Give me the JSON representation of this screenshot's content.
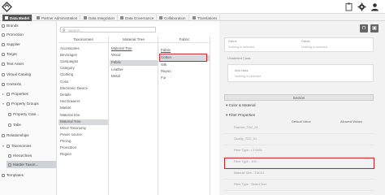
{
  "tabs": [
    {
      "label": "Data Model"
    },
    {
      "label": "Partner Administration"
    },
    {
      "label": "Data Integration"
    },
    {
      "label": "Data Governance"
    },
    {
      "label": "Collaboration"
    },
    {
      "label": "Translations"
    }
  ],
  "sidebar": {
    "items": [
      {
        "label": "Brands"
      },
      {
        "label": "Promotion"
      },
      {
        "label": "Supplier"
      },
      {
        "label": "Target"
      },
      {
        "label": "Text Asset"
      },
      {
        "label": "Virtual Catalog"
      },
      {
        "label": "Contexts"
      },
      {
        "label": "Properties"
      },
      {
        "label": "Property Groups"
      },
      {
        "label": "Property Cate..."
      },
      {
        "label": "Tabs"
      },
      {
        "label": "Relationships"
      },
      {
        "label": "Taxonomies"
      },
      {
        "label": "Hierarchies"
      },
      {
        "label": "Master Taxon..."
      },
      {
        "label": "Templates"
      }
    ]
  },
  "search": {
    "placeholder": "Search..."
  },
  "columns": {
    "taxonomies": {
      "header": "Taxonomies",
      "items": [
        "Accessories",
        "Beverages",
        "Campaigns",
        "Category",
        "Clothing",
        "Color",
        "Electronic Device",
        "Details",
        "Hat Drawers",
        "Market",
        "Material tree",
        "Material Tree",
        "Minor Taxonomy",
        "Power source",
        "Pricing",
        "Promotion",
        "Region"
      ]
    },
    "material_tree": {
      "header": "Material Tree",
      "items": [
        "Material Tree",
        "Wood",
        "Fabric",
        "Leather",
        "Metal"
      ]
    },
    "fabric": {
      "header": "Fabric",
      "items": [
        "Fabric",
        "Cotton",
        "Silk",
        "Rayon",
        "Fur"
      ]
    }
  },
  "right": {
    "field1_label": "Fabric",
    "field1_value": "Nothing is selected",
    "field2_label": "Fabric",
    "field2_value": "Nothing is selected",
    "field3_label": "Unlabelled Class",
    "field4_label": "Add class",
    "field4_value": "Nothing is selected",
    "section_label": "Section",
    "color_material": "Color & Material",
    "filter_properties": "Filter Properties",
    "th_default": "Default Value",
    "th_allowed": "Allowed Values",
    "filters": [
      "Fashion_TDC_01",
      "Quality_TDC_01",
      "Fiber Type - LT 0001",
      "Fiber Type - 100...",
      "Material Size - TDC01",
      "Fiber Type - Select Text"
    ]
  }
}
